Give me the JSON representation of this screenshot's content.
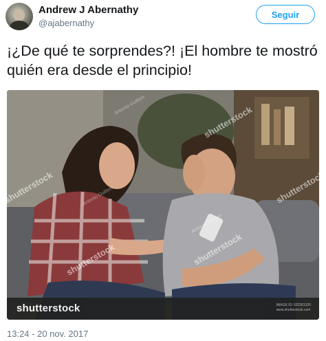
{
  "author": {
    "name": "Andrew J Abernathy",
    "handle": "@ajabernathy"
  },
  "follow_button": {
    "label": "Seguir"
  },
  "tweet": {
    "text": "¡¿De qué te sorprendes?! ¡El hombre te mostró quién era desde el principio!",
    "timestamp": "13:24 - 20 nov. 2017"
  },
  "media": {
    "watermark_logo": "shutterstock",
    "image_id_label": "IMAGE ID: 622301325",
    "image_site": "www.shutterstock.com"
  },
  "colors": {
    "accent": "#1da1f2",
    "text": "#14171a",
    "secondary_text": "#657786"
  },
  "icons": {
    "caret": "chevron-down-icon"
  }
}
